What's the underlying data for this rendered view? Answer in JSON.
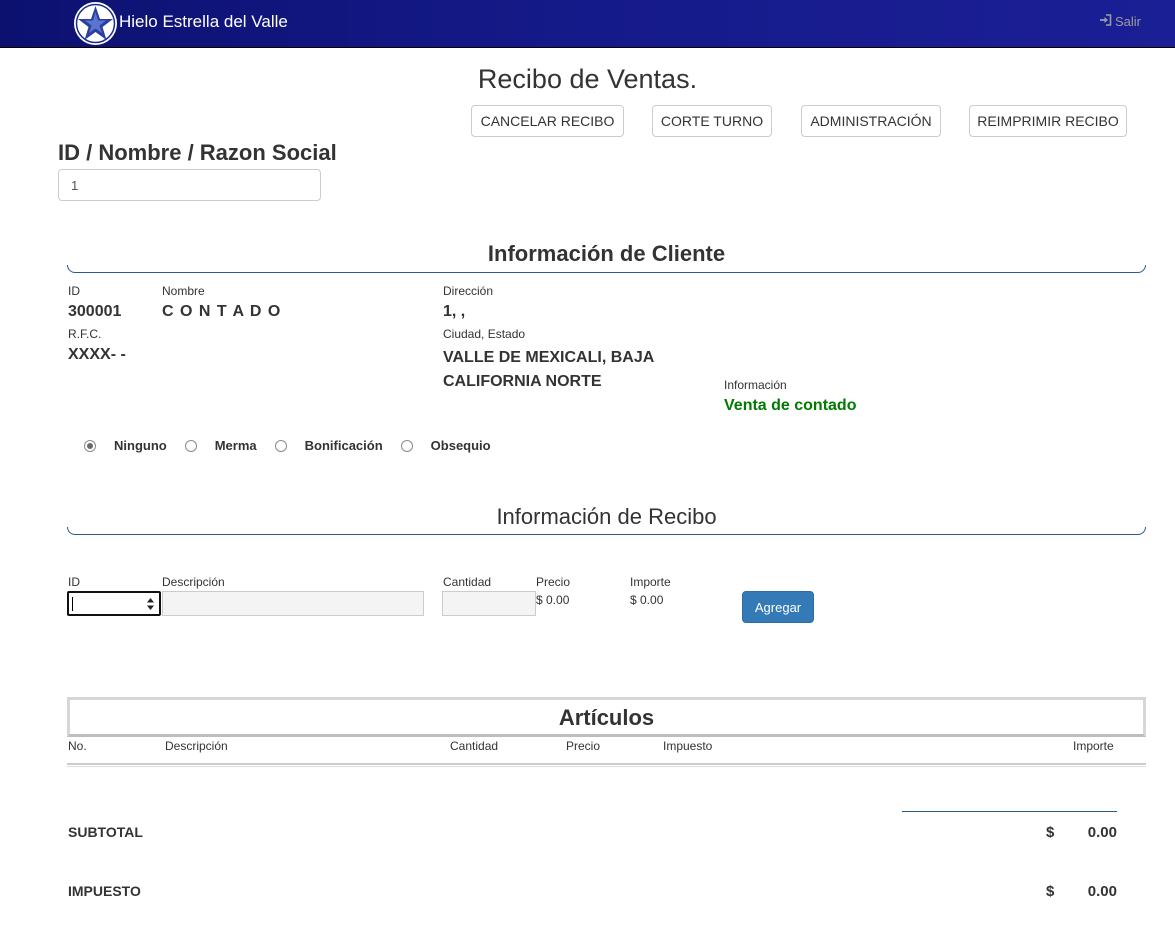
{
  "navbar": {
    "brand": "Hielo Estrella del Valle",
    "logout_label": "Salir"
  },
  "page": {
    "title": "Recibo de Ventas."
  },
  "actions": {
    "cancel_receipt": "CANCELAR RECIBO",
    "shift_cut": "CORTE TURNO",
    "administration": "ADMINISTRACIÓN",
    "reprint_receipt": "REIMPRIMIR RECIBO"
  },
  "search": {
    "label": "ID / Nombre / Razon Social",
    "value": "1"
  },
  "client": {
    "section_title": "Información de Cliente",
    "id_label": "ID",
    "id_value": "300001",
    "name_label": "Nombre",
    "name_value": "C O N T A D O",
    "address_label": "Dirección",
    "address_value": "1, ,",
    "rfc_label": "R.F.C.",
    "rfc_value": "XXXX- -",
    "city_label": "Ciudad, Estado",
    "city_value": "VALLE DE MEXICALI, BAJA CALIFORNIA NORTE",
    "info_label": "Información",
    "info_value": "Venta de contado",
    "info_color": "#007a00"
  },
  "sale_type": {
    "options": [
      "Ninguno",
      "Merma",
      "Bonificación",
      "Obsequio"
    ],
    "selected": "Ninguno"
  },
  "receipt": {
    "section_title": "Información de Recibo",
    "id_label": "ID",
    "description_label": "Descripción",
    "quantity_label": "Cantidad",
    "price_label": "Precio",
    "price_value": "$ 0.00",
    "amount_label": "Importe",
    "amount_value": "$ 0.00",
    "add_button": "Agregar"
  },
  "articles": {
    "title": "Artículos",
    "columns": [
      "No.",
      "Descripción",
      "Cantidad",
      "Precio",
      "Impuesto",
      "Importe"
    ],
    "rows": []
  },
  "totals": {
    "subtotal_label": "SUBTOTAL",
    "subtotal_currency": "$",
    "subtotal_value": "0.00",
    "tax_label": "IMPUESTO",
    "tax_currency": "$",
    "tax_value": "0.00"
  },
  "colors": {
    "navbar": "#151a8a",
    "primary": "#337ab7",
    "section_line": "#2d5a8c"
  }
}
